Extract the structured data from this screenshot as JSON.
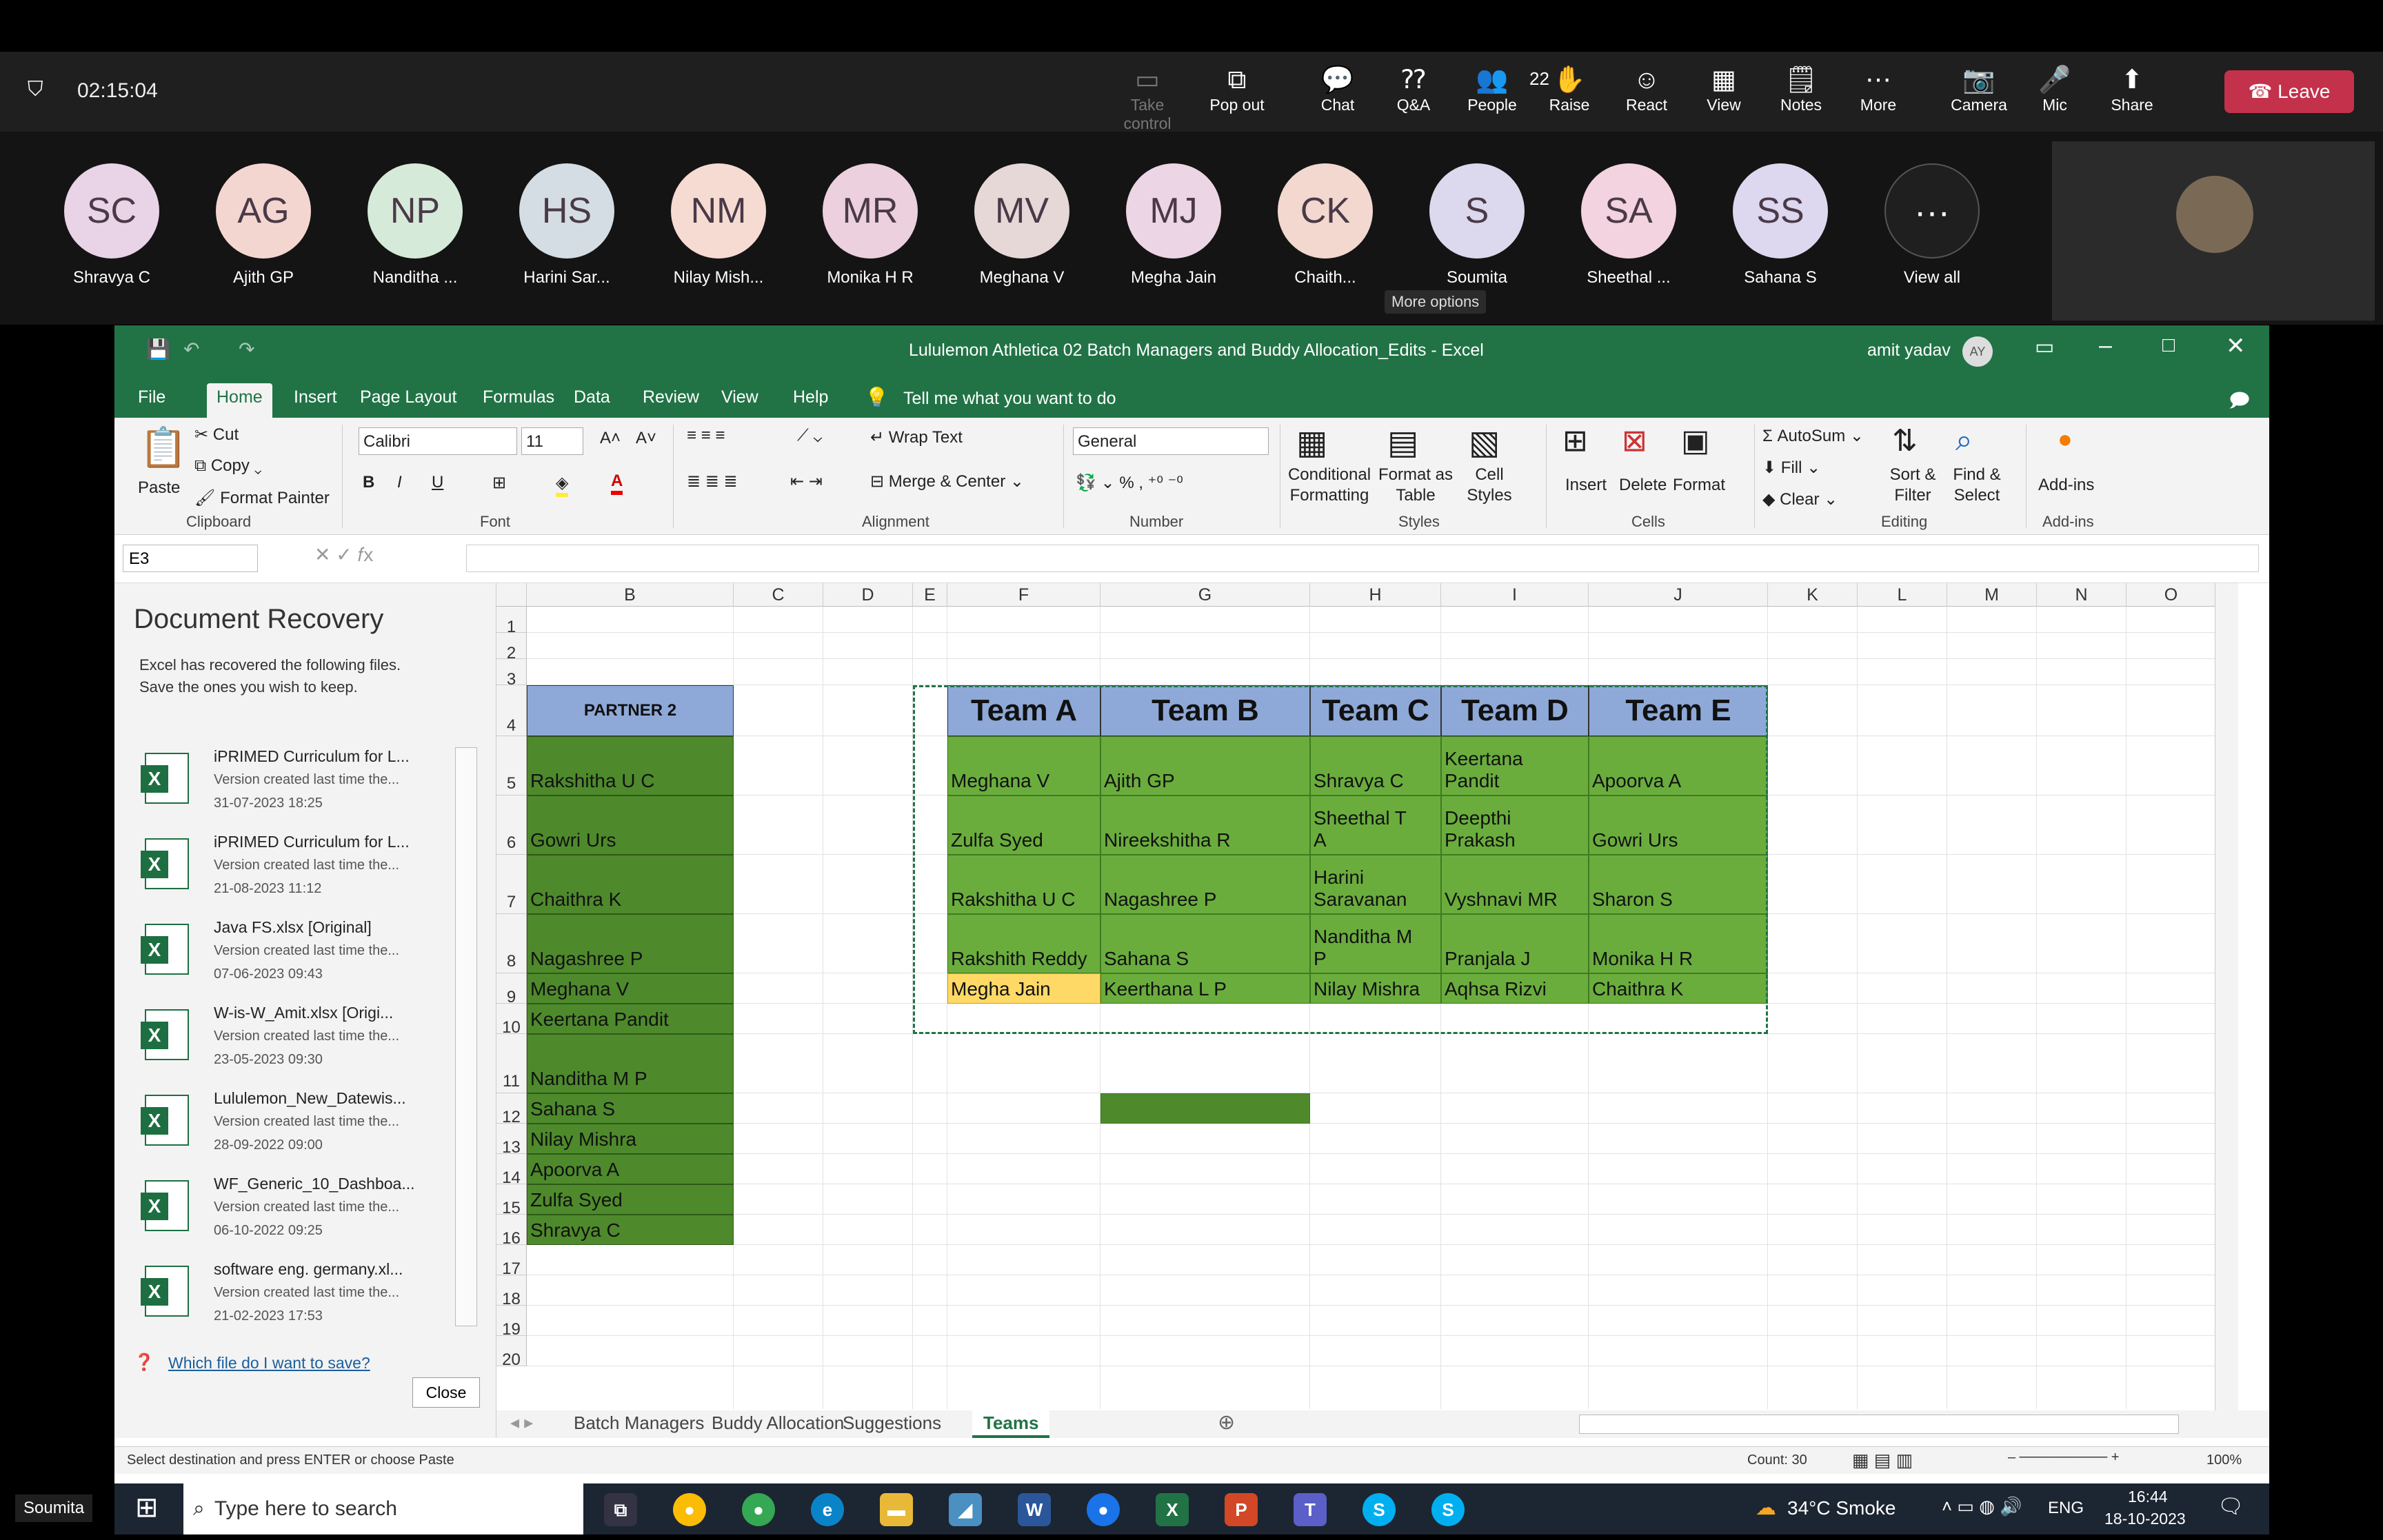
{
  "meeting": {
    "timer": "02:15:04",
    "people_count": "22",
    "leave": "Leave",
    "more_options_tip": "More options",
    "buttons": [
      {
        "label": "Take control",
        "icon": "screen-icon"
      },
      {
        "label": "Pop out",
        "icon": "popout-icon"
      },
      {
        "label": "Chat",
        "icon": "chat-icon"
      },
      {
        "label": "Q&A",
        "icon": "qa-icon"
      },
      {
        "label": "People",
        "icon": "people-icon"
      },
      {
        "label": "Raise",
        "icon": "hand-icon"
      },
      {
        "label": "React",
        "icon": "smile-icon"
      },
      {
        "label": "View",
        "icon": "grid-icon"
      },
      {
        "label": "Notes",
        "icon": "notes-icon"
      },
      {
        "label": "More",
        "icon": "more-icon"
      },
      {
        "label": "Camera",
        "icon": "camera-off-icon"
      },
      {
        "label": "Mic",
        "icon": "mic-off-icon"
      },
      {
        "label": "Share",
        "icon": "share-icon"
      }
    ],
    "participants": [
      {
        "initials": "SC",
        "name": "Shravya C",
        "color": "#e8d4e6"
      },
      {
        "initials": "AG",
        "name": "Ajith GP",
        "color": "#f4d6d0"
      },
      {
        "initials": "NP",
        "name": "Nanditha ...",
        "color": "#d6ead9"
      },
      {
        "initials": "HS",
        "name": "Harini Sar...",
        "color": "#d4dde4"
      },
      {
        "initials": "NM",
        "name": "Nilay Mish...",
        "color": "#f6dbd2"
      },
      {
        "initials": "MR",
        "name": "Monika H R",
        "color": "#ecd0de"
      },
      {
        "initials": "MV",
        "name": "Meghana V",
        "color": "#e5d8d6"
      },
      {
        "initials": "MJ",
        "name": "Megha Jain",
        "color": "#ecd5e4"
      },
      {
        "initials": "CK",
        "name": "Chaith...",
        "color": "#f2d8cf"
      },
      {
        "initials": "S",
        "name": "Soumita",
        "color": "#dcd9ee"
      },
      {
        "initials": "SA",
        "name": "Sheethal ...",
        "color": "#f3d3df"
      },
      {
        "initials": "SS",
        "name": "Sahana S",
        "color": "#ddd7ef"
      },
      {
        "initials": "···",
        "name": "View all",
        "color": "#1f1f1f"
      }
    ],
    "speaker_label": "Soumita"
  },
  "excel": {
    "title": "Lululemon Athletica 02 Batch Managers and Buddy Allocation_Edits  -  Excel",
    "user": "amit yadav",
    "user_initials": "AY",
    "tabs": [
      "File",
      "Home",
      "Insert",
      "Page Layout",
      "Formulas",
      "Data",
      "Review",
      "View",
      "Help"
    ],
    "tell_me": "Tell me what you want to do",
    "ribbon": {
      "paste": "Paste",
      "cut": "Cut",
      "copy": "Copy",
      "format_painter": "Format Painter",
      "clipboard": "Clipboard",
      "font_name": "Calibri",
      "font_size": "11",
      "font": "Font",
      "wrap_text": "Wrap Text",
      "merge_center": "Merge & Center",
      "alignment": "Alignment",
      "number_format": "General",
      "number": "Number",
      "conditional": "Conditional Formatting",
      "format_table": "Format as Table",
      "cell_styles": "Cell Styles",
      "styles": "Styles",
      "insert": "Insert",
      "delete": "Delete",
      "format": "Format",
      "cells": "Cells",
      "autosum": "AutoSum",
      "fill": "Fill",
      "clear": "Clear",
      "sort_filter": "Sort & Filter",
      "find_select": "Find & Select",
      "editing": "Editing",
      "addins": "Add-ins"
    },
    "name_box": "E3",
    "doc_recovery": {
      "title": "Document Recovery",
      "desc1": "Excel has recovered the following files.",
      "desc2": "Save the ones you wish to keep.",
      "which": "Which file do I want to save?",
      "close": "Close",
      "files": [
        {
          "name": "iPRIMED Curriculum for L...",
          "desc": "Version created last time the...",
          "time": "31-07-2023 18:25"
        },
        {
          "name": "iPRIMED Curriculum for L...",
          "desc": "Version created last time the...",
          "time": "21-08-2023 11:12"
        },
        {
          "name": "Java FS.xlsx  [Original]",
          "desc": "Version created last time the...",
          "time": "07-06-2023 09:43"
        },
        {
          "name": "W-is-W_Amit.xlsx  [Origi...",
          "desc": "Version created last time the...",
          "time": "23-05-2023 09:30"
        },
        {
          "name": "Lululemon_New_Datewis...",
          "desc": "Version created last time the...",
          "time": "28-09-2022 09:00"
        },
        {
          "name": "WF_Generic_10_Dashboa...",
          "desc": "Version created last time the...",
          "time": "06-10-2022 09:25"
        },
        {
          "name": "software eng. germany.xl...",
          "desc": "Version created last time the...",
          "time": "21-02-2023 17:53"
        }
      ]
    },
    "columns": [
      "B",
      "C",
      "D",
      "E",
      "F",
      "G",
      "H",
      "I",
      "J",
      "K",
      "L",
      "M",
      "N",
      "O"
    ],
    "rows": [
      "1",
      "2",
      "3",
      "4",
      "5",
      "6",
      "7",
      "8",
      "9",
      "10",
      "11",
      "12",
      "13",
      "14",
      "15",
      "16",
      "17",
      "18",
      "19",
      "20"
    ],
    "partner_header": "PARTNER 2",
    "partner": [
      "Rakshitha U C",
      "Gowri Urs",
      "Chaithra K",
      "Nagashree  P",
      "Meghana  V",
      "Keertana Pandit",
      "Nanditha M P",
      "Sahana S",
      "Nilay Mishra",
      "Apoorva  A",
      "Zulfa  Syed",
      "Shravya C"
    ],
    "teams": [
      "Team A",
      "Team B",
      "Team C",
      "Team D",
      "Team E"
    ],
    "team_rows": [
      [
        "Meghana V",
        "Ajith GP",
        "Shravya C",
        "Keertana\nPandit",
        "Apoorva  A"
      ],
      [
        "Zulfa  Syed",
        "Nireekshitha   R",
        "Sheethal   T\nA",
        "Deepthi\nPrakash",
        "Gowri Urs"
      ],
      [
        "Rakshitha U C",
        "Nagashree  P",
        "Harini\nSaravanan",
        "Vyshnavi MR",
        "Sharon S"
      ],
      [
        "Rakshith Reddy",
        "Sahana S",
        "Nanditha M\nP",
        "Pranjala  J",
        "Monika  H R"
      ],
      [
        "Megha Jain",
        "Keerthana L P",
        "Nilay Mishra",
        "Aqhsa  Rizvi",
        "Chaithra K"
      ]
    ],
    "sheets": [
      "Batch Managers",
      "Buddy Allocation",
      "Suggestions",
      "Teams"
    ],
    "status_left": "Select destination and press ENTER or choose Paste",
    "count": "Count: 30",
    "zoom": "100%"
  },
  "taskbar": {
    "search": "Type here to search",
    "weather": "34°C  Smoke",
    "lang": "ENG",
    "time": "16:44",
    "date": "18-10-2023"
  }
}
